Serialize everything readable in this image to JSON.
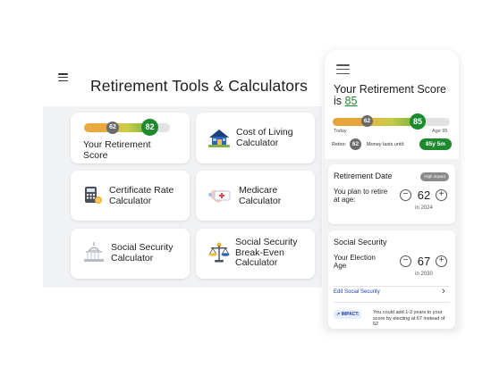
{
  "tablet": {
    "title": "Retirement Tools & Calculators",
    "cards": {
      "score": {
        "label": "Your Retirement Score",
        "today_score": "62",
        "target_score": "82"
      },
      "cost_of_living": {
        "label": "Cost of Living Calculator",
        "icon": "house-icon"
      },
      "certificate_rate": {
        "label": "Certificate Rate Calculator",
        "icon": "calculator-icon"
      },
      "medicare": {
        "label": "Medicare Calculator",
        "icon": "medicare-icon"
      },
      "social_security": {
        "label": "Social Security Calculator",
        "icon": "capitol-icon"
      },
      "ss_break_even": {
        "label": "Social Security Break-Even Calculator",
        "icon": "scales-icon"
      }
    }
  },
  "phone": {
    "score_title": "Your Retirement Score is",
    "score_value": "85",
    "today_score": "62",
    "target_score": "85",
    "today_label": "Today",
    "age_label": "Age 95",
    "retire_label": "Retire:",
    "retire_score": "62",
    "money_label": "Money lasts until:",
    "money_value": "85y 5m",
    "retirement_date": {
      "title": "Retirement Date",
      "badge": "High impact",
      "field_label": "You plan to retire at age:",
      "value": "62",
      "sub": "in 2024",
      "minus": "−",
      "plus": "+"
    },
    "social_security": {
      "title": "Social Security",
      "field_label": "Your Election Age",
      "value": "67",
      "sub": "in 2030",
      "minus": "−",
      "plus": "+",
      "edit_link": "Edit Social Security",
      "chevron": "›",
      "impact_badge": "↗ IMPACT:",
      "impact_text": "You could add 1-2 years to your score by electing at 67 instead of 62"
    }
  },
  "colors": {
    "score_green": "#1e8a2f",
    "pin_grey": "#6b6b6b",
    "link_blue": "#1a3fa8"
  }
}
